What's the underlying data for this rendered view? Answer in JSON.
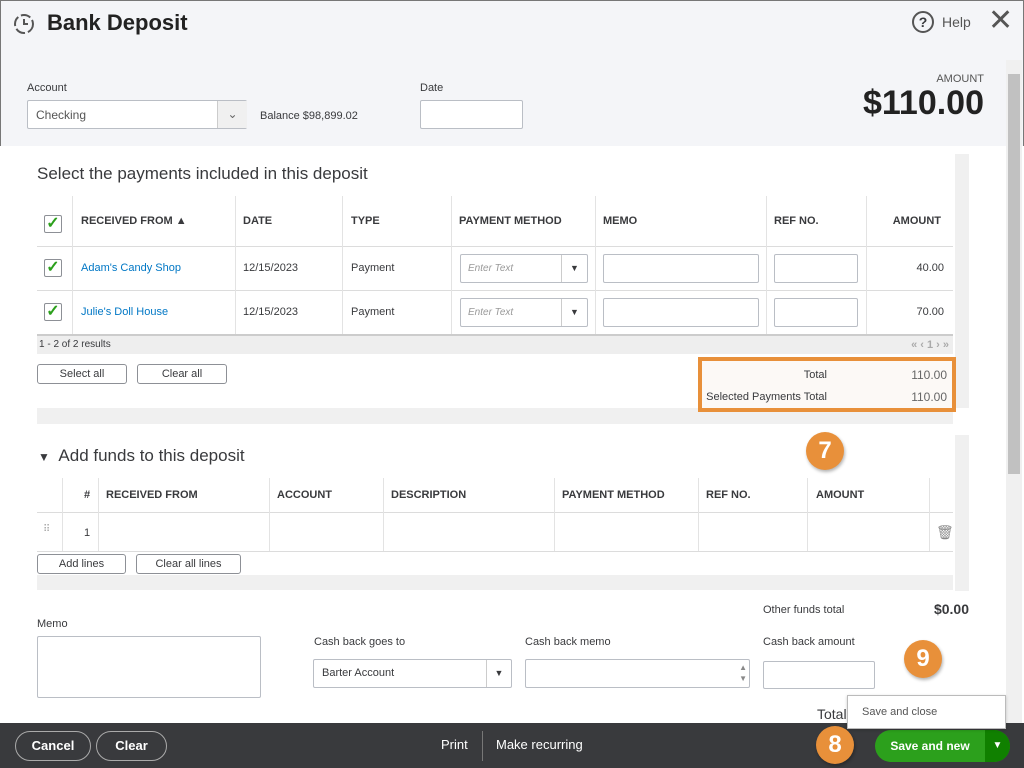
{
  "header": {
    "title": "Bank Deposit",
    "help": "Help",
    "account_label": "Account",
    "account_value": "Checking",
    "balance": "Balance $98,899.02",
    "date_label": "Date",
    "date_value": "",
    "amount_label": "AMOUNT",
    "amount_value": "$110.00"
  },
  "payments": {
    "heading": "Select the payments included in this deposit",
    "columns": [
      "RECEIVED FROM",
      "DATE",
      "TYPE",
      "PAYMENT METHOD",
      "MEMO",
      "REF NO.",
      "AMOUNT"
    ],
    "rows": [
      {
        "checked": true,
        "from": "Adam's Candy Shop",
        "date": "12/15/2023",
        "type": "Payment",
        "method_placeholder": "Enter Text",
        "amount": "40.00"
      },
      {
        "checked": true,
        "from": "Julie's Doll House",
        "date": "12/15/2023",
        "type": "Payment",
        "method_placeholder": "Enter Text",
        "amount": "70.00"
      }
    ],
    "results": "1 - 2 of 2 results",
    "page": "1",
    "select_all": "Select all",
    "clear_all": "Clear all",
    "total_label": "Total",
    "total_value": "110.00",
    "selected_label": "Selected Payments Total",
    "selected_value": "110.00"
  },
  "funds": {
    "heading": "Add funds to this deposit",
    "columns": [
      "#",
      "RECEIVED FROM",
      "ACCOUNT",
      "DESCRIPTION",
      "PAYMENT METHOD",
      "REF NO.",
      "AMOUNT"
    ],
    "rows": [
      {
        "num": "1"
      }
    ],
    "add_lines": "Add lines",
    "clear_lines": "Clear all lines",
    "other_total_label": "Other funds total",
    "other_total_value": "$0.00"
  },
  "bottom": {
    "memo_label": "Memo",
    "cashback_to_label": "Cash back goes to",
    "cashback_to_value": "Barter Account",
    "cashback_memo_label": "Cash back memo",
    "cashback_amount_label": "Cash back amount",
    "total_label": "Total"
  },
  "footer": {
    "cancel": "Cancel",
    "clear": "Clear",
    "print": "Print",
    "recurring": "Make recurring",
    "save_new": "Save and new",
    "save_close": "Save and close"
  },
  "callouts": [
    "7",
    "8",
    "9"
  ],
  "colors": {
    "accent_green": "#2ca01c",
    "callout": "#e8903a",
    "link": "#0077c5"
  }
}
